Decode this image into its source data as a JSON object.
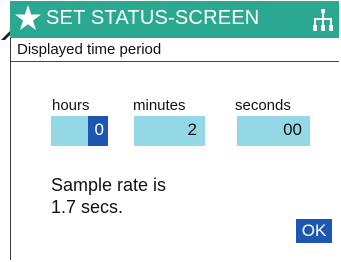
{
  "header": {
    "title": "SET STATUS-SCREEN",
    "left_icon": "star-icon",
    "right_icon": "network-tree-icon",
    "color": "#2aa890"
  },
  "subheader": {
    "title": "Displayed time period"
  },
  "time_period": {
    "hours": {
      "label": "hours",
      "value": "0"
    },
    "minutes": {
      "label": "minutes",
      "value": "2"
    },
    "seconds": {
      "label": "seconds",
      "value": "00"
    }
  },
  "sample_rate": {
    "line1": "Sample rate is",
    "line2": "1.7 secs."
  },
  "ok_button": {
    "label": "OK"
  },
  "colors": {
    "field_bg": "#94d8e6",
    "selection": "#1e56b4"
  }
}
